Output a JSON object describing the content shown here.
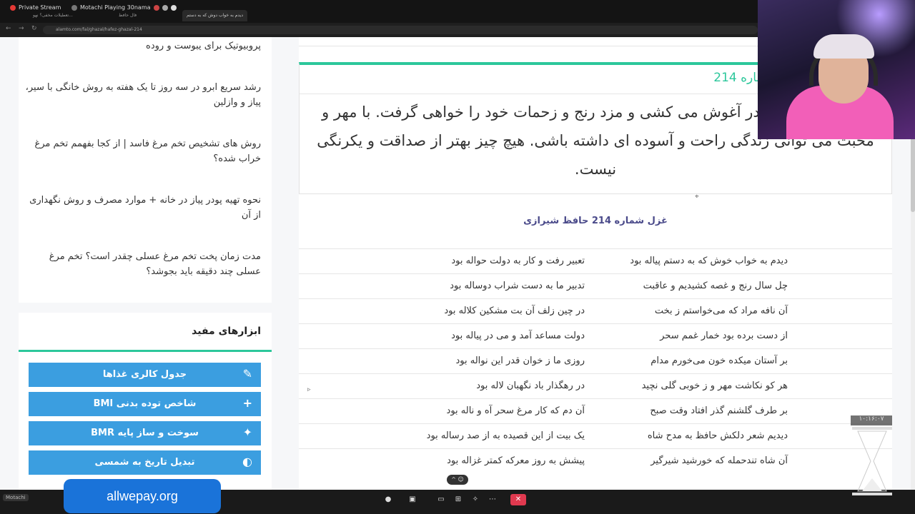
{
  "browser": {
    "tabs": [
      {
        "label": "Private Stream"
      },
      {
        "label": "Motachi Playing 30nama"
      }
    ],
    "tab_titles": [
      "تعطیلات مخفی؟ نهو...",
      "فال حافظ",
      "دیدم به خواب دوش که به دستم"
    ],
    "url": "alamto.com/fal/ghazal/hafez-ghazal-214"
  },
  "sidebar": {
    "links": [
      {
        "label": "پروبیوتیک برای یبوست و روده"
      },
      {
        "label": "رشد سریع ابرو در سه روز تا یک هفته به روش خانگی با سیر، پیاز و وازلین"
      },
      {
        "label": "روش های تشخیص تخم مرغ فاسد | از کجا بفهمم تخم مرغ خراب شده؟"
      },
      {
        "label": "نحوه تهیه پودر پیاز در خانه + موارد مصرف و روش نگهداری از آن"
      },
      {
        "label": "مدت زمان پخت تخم مرغ عسلی چقدر است؟ تخم مرغ عسلی چند دقیقه باید بجوشد؟"
      }
    ],
    "tools_title": "ابزارهای مفید",
    "tools": [
      {
        "label": "جدول کالری غذاها",
        "icon": "✎"
      },
      {
        "label": "شاخص توده بدنی BMI",
        "icon": "+"
      },
      {
        "label": "سوخت و ساز پایه BMR",
        "icon": "✦"
      },
      {
        "label": "تبدیل تاریخ به شمسی",
        "icon": "◐"
      }
    ]
  },
  "main": {
    "meaning_heading": "فال شما؛ غزل حافظ شماره 214",
    "meaning_text": "بخت و مقصود را در آغوش می کشی و مزد رنج و زحمات خود را خواهی گرفت. با مهر و محبت می توانی زندگی راحت و آسوده ای داشته باشی. هیچ چیز بهتر از صداقت و یکرنگی نیست.",
    "poem_title": "غزل شماره 214 حافظ شیرازی",
    "verses": [
      {
        "m1": "دیدم به خواب خوش که به دستم پیاله بود",
        "m2": "تعبیر رفت و کار به دولت حواله بود"
      },
      {
        "m1": "چل سال رنج و غصه کشیدیم و عاقبت",
        "m2": "تدبیر ما به دست شراب دوساله بود"
      },
      {
        "m1": "آن نافه مراد که می‌خواستم ز بخت",
        "m2": "در چین زلف آن بت مشکین کلاله بود"
      },
      {
        "m1": "از دست برده بود خمار غمم سحر",
        "m2": "دولت مساعد آمد و می در پیاله بود"
      },
      {
        "m1": "بر آستان میکده خون می‌خورم مدام",
        "m2": "روزی ما ز خوان قدر این نواله بود"
      },
      {
        "m1": "هر کو نکاشت مهر و ز خوبی گلی نچید",
        "m2": "در رهگذار باد نگهبان لاله بود"
      },
      {
        "m1": "بر طرف گلشنم گذر افتاد وقت صبح",
        "m2": "آن دم که کار مرغ سحر آه و ناله بود"
      },
      {
        "m1": "دیدیم شعر دلکش حافظ به مدح شاه",
        "m2": "یک بیت از این قصیده به از صد رساله بود"
      },
      {
        "m1": "آن شاه تندحمله که خورشید شیرگیر",
        "m2": "پیشش به روز معرکه کمتر غزاله بود"
      }
    ]
  },
  "overlay": {
    "promo": "allwepay.org",
    "streamer_name": "Motachi",
    "timer": "۱۰:۱۶:۰۷",
    "accent_color": "#2cc79b",
    "button_color": "#3b9ee0"
  }
}
